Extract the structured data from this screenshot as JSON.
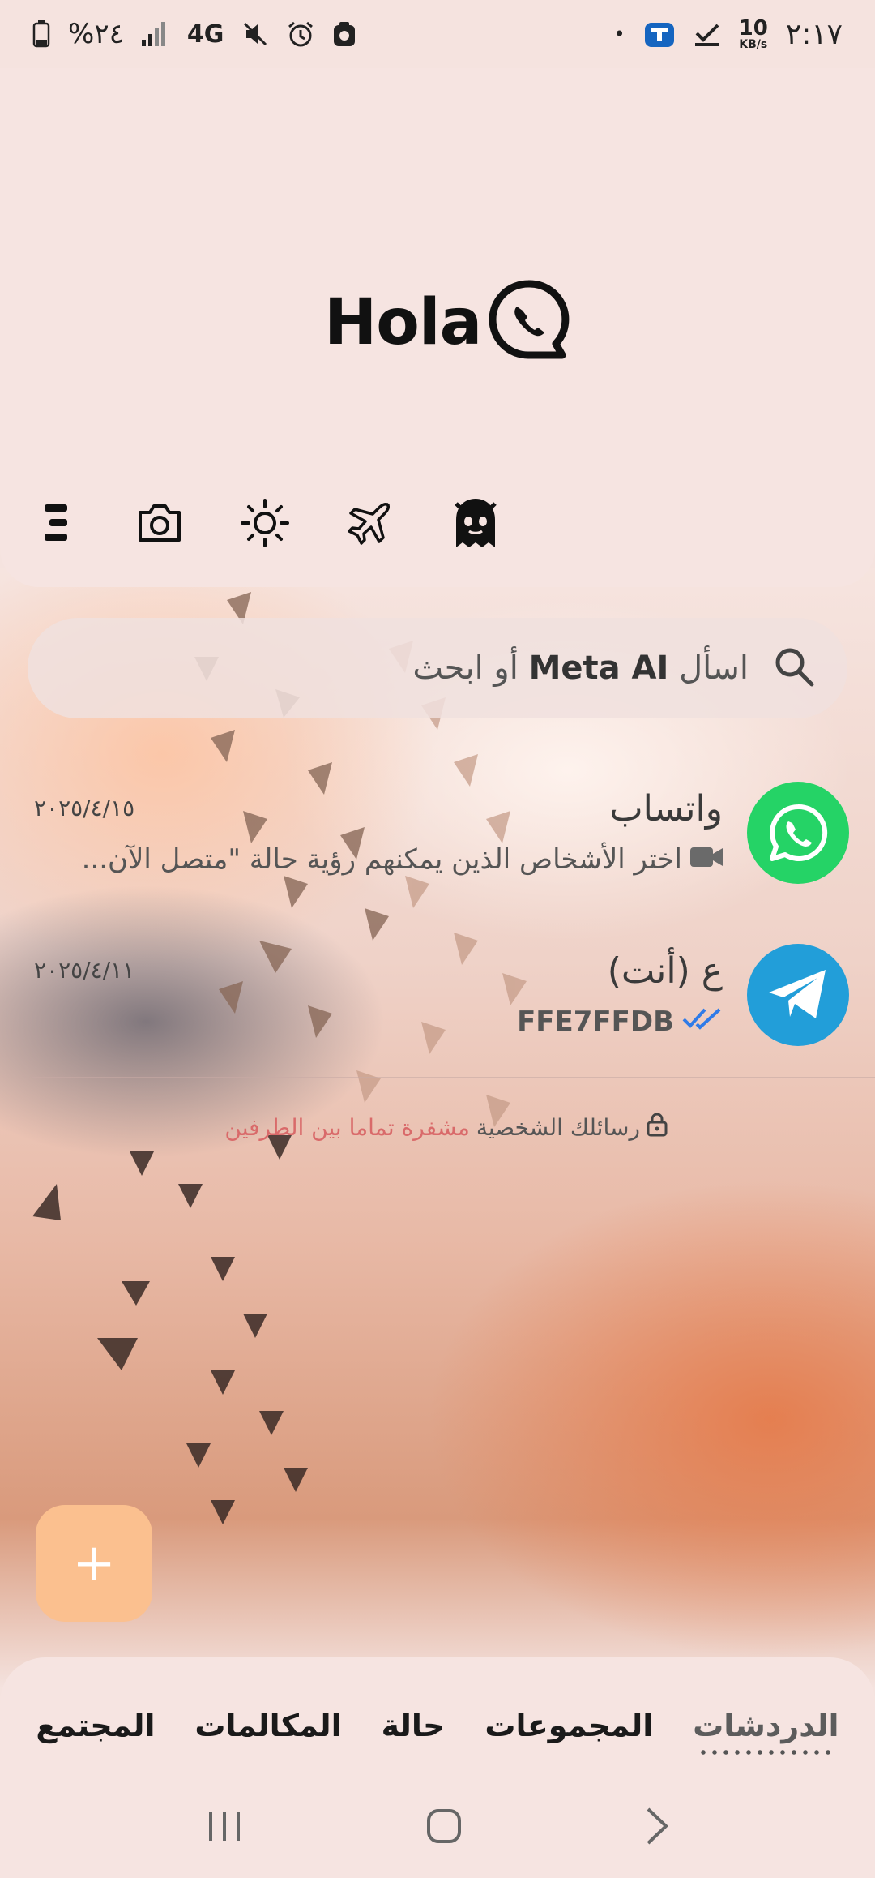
{
  "status_bar": {
    "time": "٢:١٧",
    "net_speed_value": "10",
    "net_speed_unit": "KB/s",
    "battery_text": "%٢٤",
    "network_type": "4G",
    "dot": "•"
  },
  "header": {
    "logo_text": "Hola"
  },
  "search": {
    "placeholder_prefix": "اسأل",
    "placeholder_brand": "Meta AI",
    "placeholder_suffix": "أو ابحث"
  },
  "chats": [
    {
      "name": "واتساب",
      "date": "٢٠٢٥/٤/١٥",
      "preview": "اختر الأشخاص الذين يمكنهم رؤية حالة \"متصل الآن...",
      "avatar_icon": "whatsapp-icon",
      "avatar_color": "#25d366"
    },
    {
      "name": "ع (أنت)",
      "date": "٢٠٢٥/٤/١١",
      "preview": "FFE7FFDB",
      "avatar_icon": "telegram-icon",
      "avatar_color": "#229ed9"
    }
  ],
  "encrypted_notice": {
    "text": "رسائلك الشخصية",
    "link": "مشفرة تماما بين الطرفين"
  },
  "tabs": [
    {
      "label": "الدردشات",
      "active": true
    },
    {
      "label": "المجموعات",
      "active": false
    },
    {
      "label": "حالة",
      "active": false
    },
    {
      "label": "المكالمات",
      "active": false
    },
    {
      "label": "المجتمع",
      "active": false
    }
  ],
  "fab": {
    "label": "+"
  },
  "colors": {
    "fab": "#fbc08f",
    "whatsapp": "#25d366",
    "telegram": "#229ed9",
    "read_ticks": "#2f7be8"
  }
}
